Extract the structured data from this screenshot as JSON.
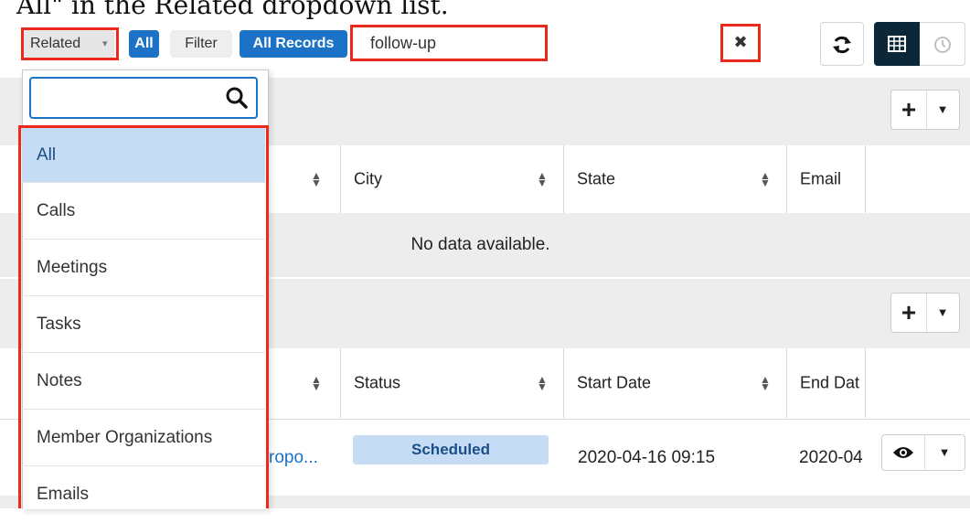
{
  "caption": "All\" in the Related dropdown list.",
  "filterbar": {
    "related_label": "Related",
    "related_caret": "▾",
    "all_label": "All",
    "filter_label": "Filter",
    "all_records_label": "All Records",
    "search_value": "follow-up",
    "clear_label": "✖"
  },
  "toolbar": {
    "refresh_icon": "refresh-icon",
    "grid_icon": "grid-view-icon",
    "clock_icon": "clock-icon"
  },
  "dropdown": {
    "search_placeholder": "",
    "items": [
      {
        "label": "All",
        "active": true
      },
      {
        "label": "Calls"
      },
      {
        "label": "Meetings"
      },
      {
        "label": "Tasks"
      },
      {
        "label": "Notes"
      },
      {
        "label": "Member Organizations"
      },
      {
        "label": "Emails"
      }
    ]
  },
  "subpanel1": {
    "columns": [
      "City",
      "State",
      "Email"
    ],
    "empty_text": "No data available."
  },
  "subpanel2": {
    "columns": [
      "Status",
      "Start Date",
      "End Dat"
    ],
    "row": {
      "name_fragment": "ropo...",
      "status": "Scheduled",
      "start_date": "2020-04-16 09:15",
      "end_date": "2020-04"
    }
  },
  "colors": {
    "accent": "#1b72c6",
    "highlight": "#ea2a1c",
    "badge_bg": "#c5dcf4"
  }
}
